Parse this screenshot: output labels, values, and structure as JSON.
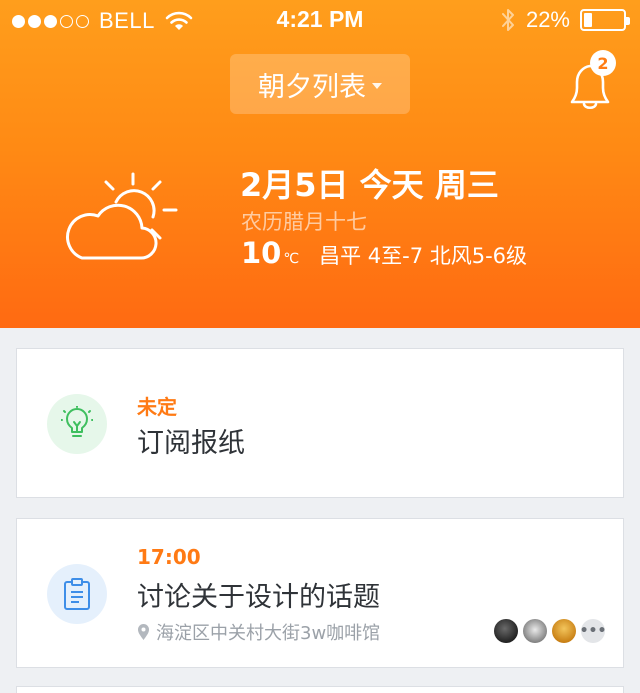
{
  "status_bar": {
    "carrier": "BELL",
    "signal_dots_filled": 3,
    "signal_dots_total": 5,
    "time": "4:21 PM",
    "battery_text": "22%",
    "battery_level": 0.22
  },
  "header": {
    "title": "朝夕列表",
    "notification_count": "2",
    "date": "2月5日  今天  周三",
    "lunar": "农历腊月十七",
    "temperature": "10",
    "temperature_unit": "℃",
    "weather_detail": "昌平  4至-7  北风5-6级",
    "weather_icon": "partly-cloudy-icon"
  },
  "tasks": [
    {
      "tag": "未定",
      "title": "订阅报纸",
      "icon": "lightbulb-icon"
    },
    {
      "tag": "17:00",
      "title": "讨论关于设计的话题",
      "icon": "clipboard-icon",
      "location": "海淀区中关村大街3w咖啡馆",
      "participants_more": "•••"
    }
  ],
  "colors": {
    "header_top": "#ff9e1c",
    "header_bottom": "#ff6a12",
    "accent": "#ff7a14",
    "idea_green": "#3fbf5f",
    "task_blue": "#3e8ee8"
  }
}
